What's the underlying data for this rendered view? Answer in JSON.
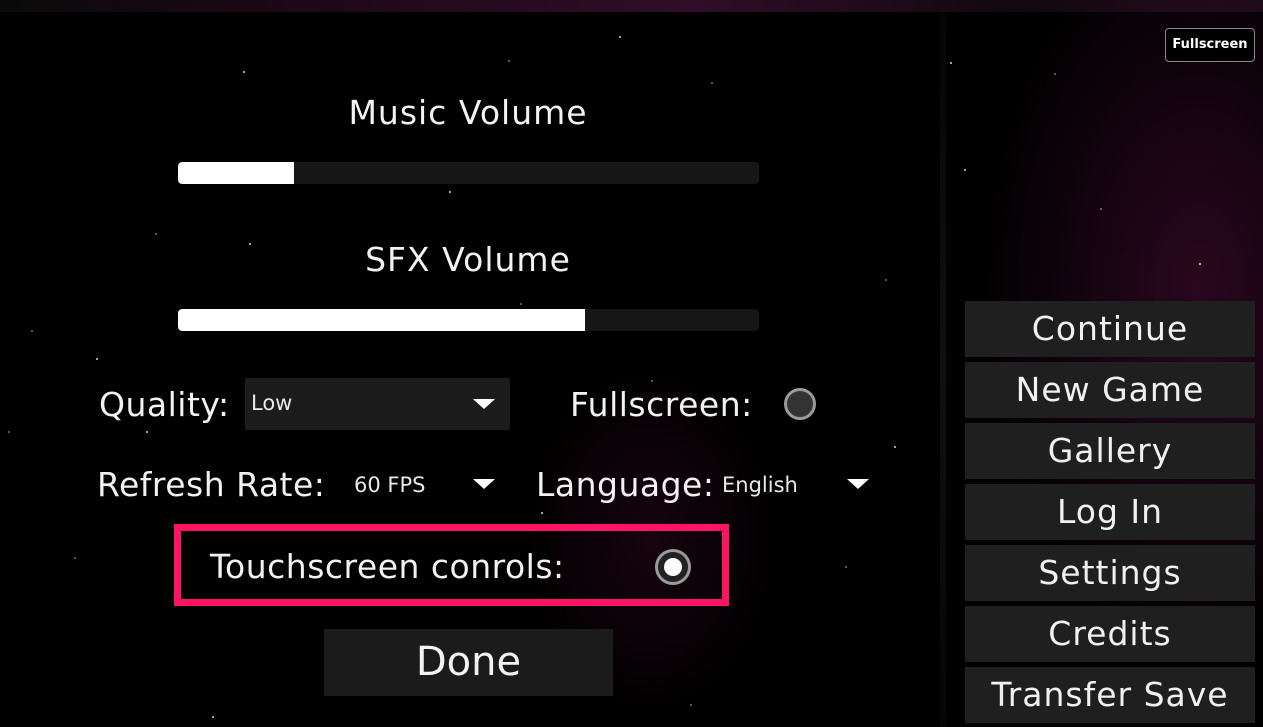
{
  "topbar": {
    "fullscreen_button": "Fullscreen"
  },
  "settings": {
    "music_volume": {
      "label": "Music Volume",
      "level": 0.2
    },
    "sfx_volume": {
      "label": "SFX Volume",
      "level": 0.7
    },
    "quality": {
      "label": "Quality:",
      "value": "Low"
    },
    "fullscreen": {
      "label": "Fullscreen:",
      "enabled": false
    },
    "refresh_rate": {
      "label": "Refresh Rate:",
      "value": "60 FPS"
    },
    "language": {
      "label": "Language:",
      "value": "English"
    },
    "touchscreen": {
      "label": "Touchscreen conrols:",
      "enabled": true
    },
    "done_label": "Done"
  },
  "main_menu": {
    "items": [
      "Continue",
      "New Game",
      "Gallery",
      "Log In",
      "Settings",
      "Credits",
      "Transfer Save"
    ]
  },
  "colors": {
    "highlight": "#ff1463",
    "panel": "#1f1f1f",
    "background": "#000000"
  },
  "icons": {
    "caret": "caret-down-icon",
    "toggle": "radio-toggle-icon"
  }
}
